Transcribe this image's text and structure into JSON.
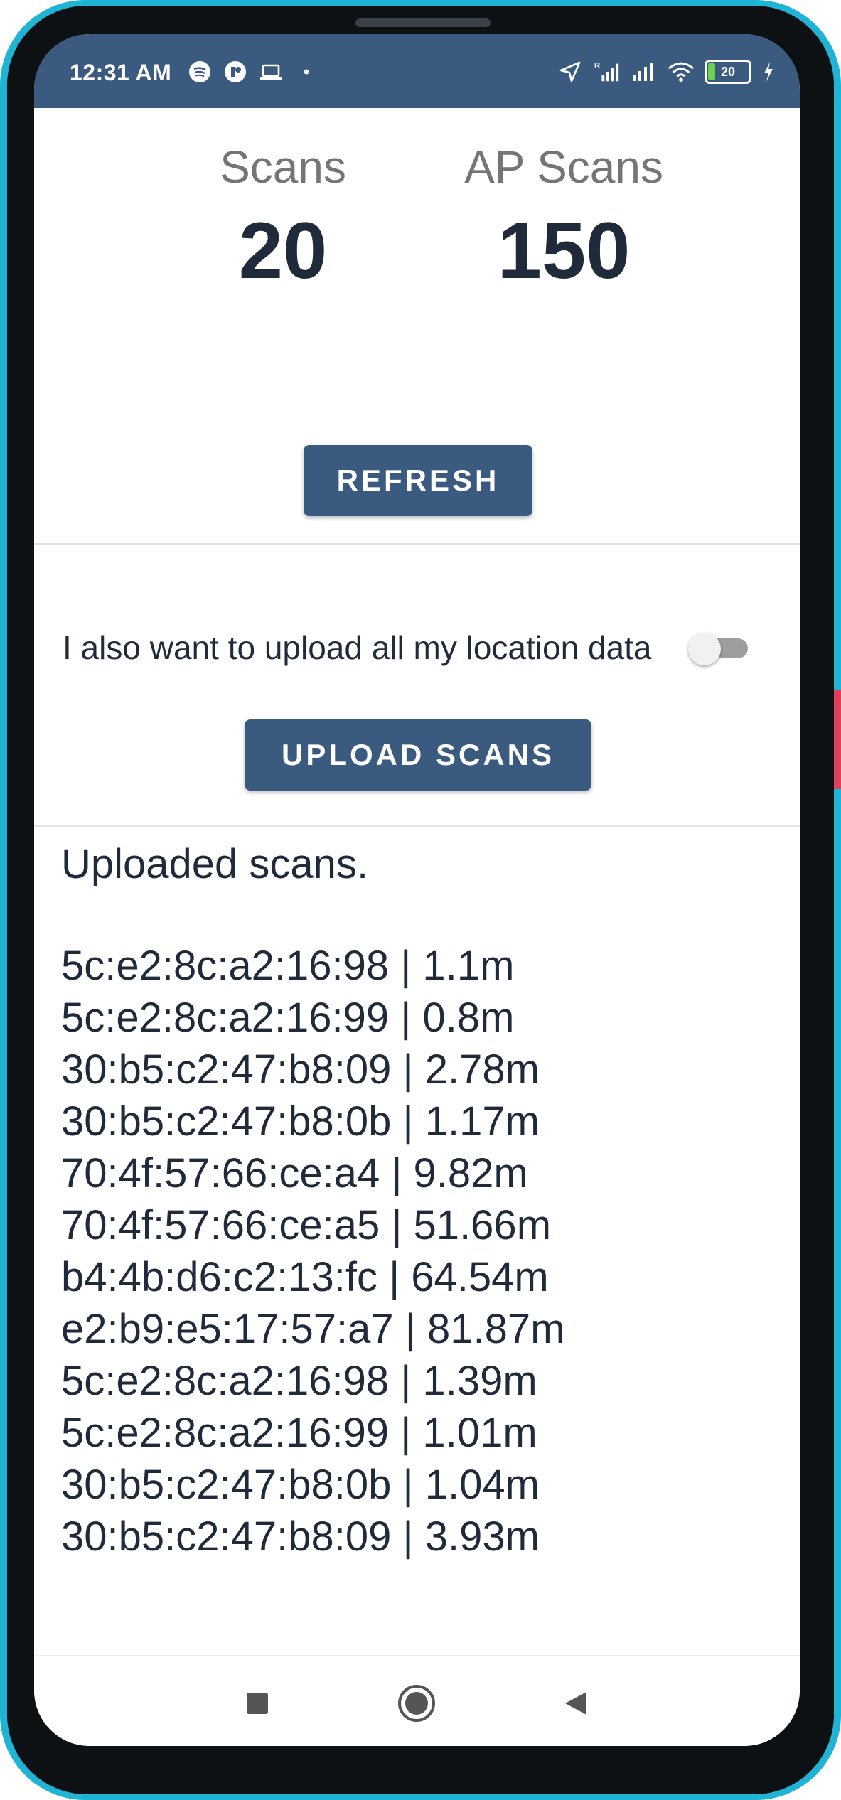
{
  "status_bar": {
    "time": "12:31 AM",
    "left_icons": [
      "spotify-icon",
      "app-icon",
      "laptop-icon",
      "dot-icon"
    ],
    "right_icons": [
      "location-arrow-icon",
      "signal-roaming-icon",
      "signal-icon",
      "wifi-icon",
      "battery-icon",
      "charging-icon"
    ],
    "battery_level": "20"
  },
  "stats": {
    "scans_label": "Scans",
    "scans_value": "20",
    "ap_scans_label": "AP Scans",
    "ap_scans_value": "150"
  },
  "refresh_button": "REFRESH",
  "location_toggle": {
    "label": "I also want to upload all my location data",
    "checked": false
  },
  "upload_button": "UPLOAD SCANS",
  "uploaded": {
    "header": "Uploaded scans.",
    "entries": [
      "5c:e2:8c:a2:16:98 | 1.1m",
      "5c:e2:8c:a2:16:99 | 0.8m",
      "30:b5:c2:47:b8:09 | 2.78m",
      "30:b5:c2:47:b8:0b | 1.17m",
      "70:4f:57:66:ce:a4 | 9.82m",
      "70:4f:57:66:ce:a5 | 51.66m",
      "b4:4b:d6:c2:13:fc | 64.54m",
      "e2:b9:e5:17:57:a7 | 81.87m",
      "5c:e2:8c:a2:16:98 | 1.39m",
      "5c:e2:8c:a2:16:99 | 1.01m",
      "30:b5:c2:47:b8:0b | 1.04m",
      "30:b5:c2:47:b8:09 | 3.93m"
    ]
  },
  "nav_bar": {
    "buttons": [
      "recents-square-icon",
      "home-circle-icon",
      "back-triangle-icon"
    ]
  },
  "colors": {
    "primary": "#3b5a80",
    "frame": "#1fb3d6",
    "text_dark": "#1f2a3a",
    "text_muted": "#757575"
  }
}
